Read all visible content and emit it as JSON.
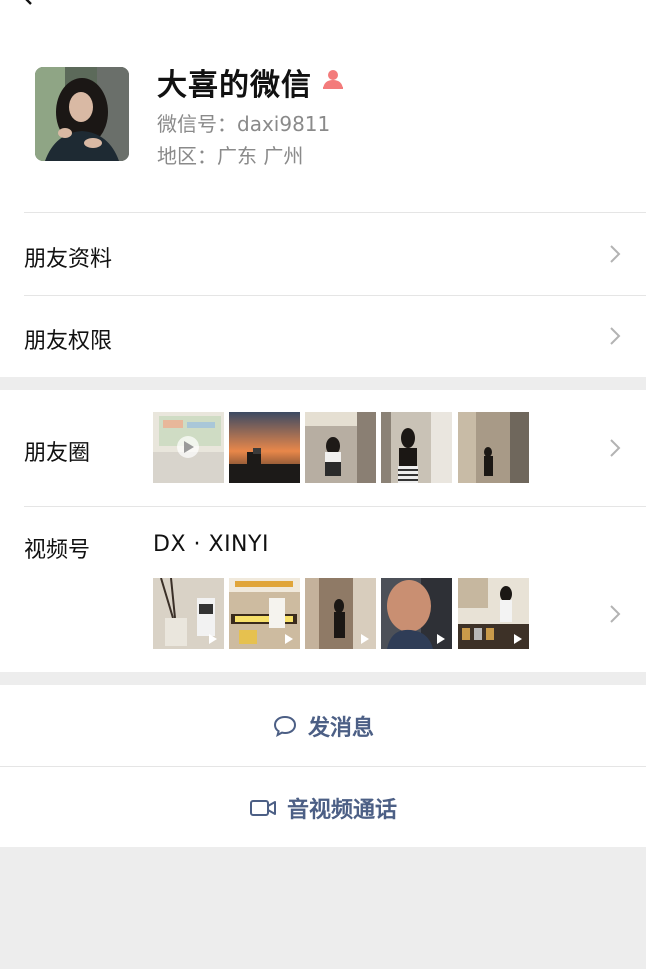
{
  "profile": {
    "name": "大喜的微信",
    "wechat_id": "微信号：daxi9811",
    "region": "地区：广东 广州"
  },
  "rows": {
    "friend_info": "朋友资料",
    "friend_permissions": "朋友权限",
    "moments": "朋友圈",
    "channels": "视频号"
  },
  "channels": {
    "name": "DX · XINYI"
  },
  "actions": {
    "message": "发消息",
    "call": "音视频通话"
  },
  "icons": {
    "back": "back-arrow-icon",
    "badge": "person-badge-icon",
    "chevron": "chevron-right-icon",
    "message": "chat-bubble-icon",
    "call": "video-camera-icon"
  },
  "colors": {
    "link_blue": "#4c5f85",
    "badge_red": "#f37b7b",
    "secondary_text": "#8a8a8a"
  }
}
